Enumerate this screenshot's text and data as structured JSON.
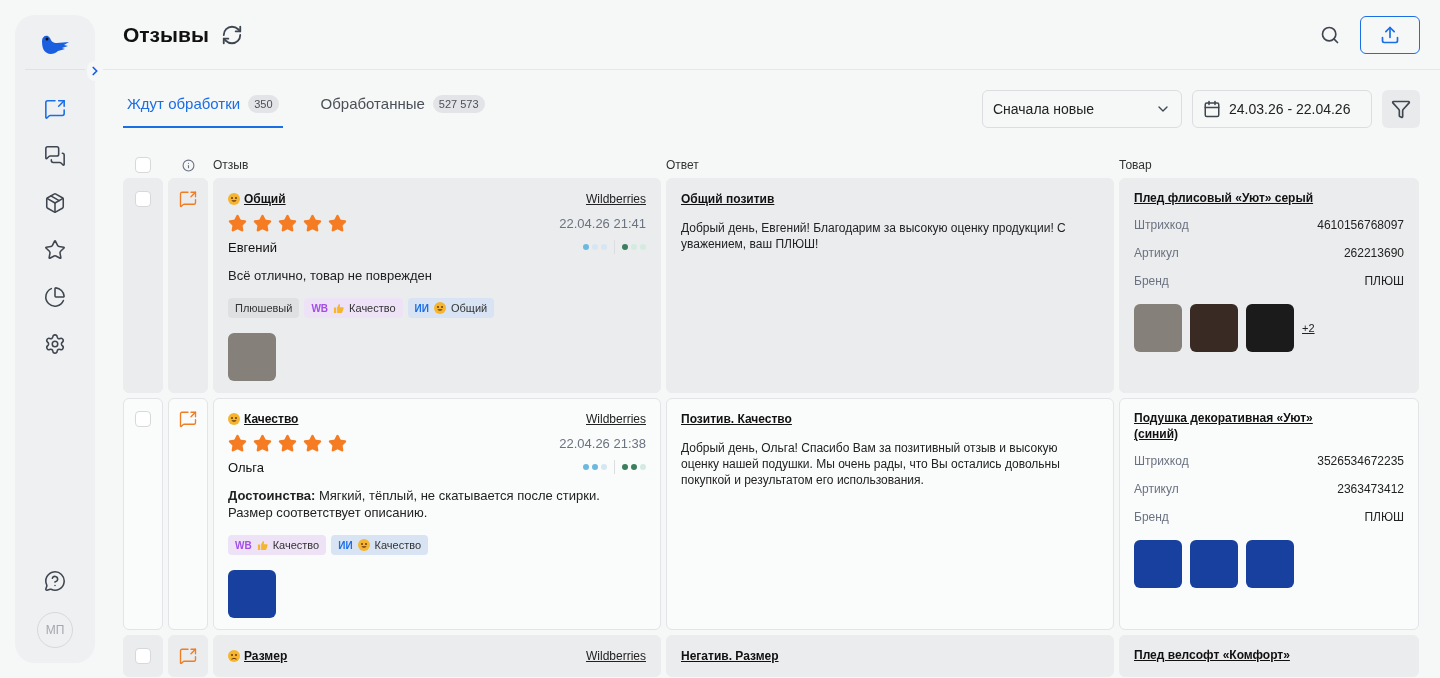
{
  "sidebar": {
    "items": [
      {
        "kind": "reviews",
        "selected": true
      },
      {
        "kind": "chats",
        "selected": false
      },
      {
        "kind": "products",
        "selected": false
      },
      {
        "kind": "ratings",
        "selected": false
      },
      {
        "kind": "analytics",
        "selected": false
      },
      {
        "kind": "settings",
        "selected": false
      }
    ],
    "avatar": "МП"
  },
  "header": {
    "title": "Отзывы"
  },
  "tabs": [
    {
      "label": "Ждут обработки",
      "count": "350",
      "selected": true
    },
    {
      "label": "Обработанные",
      "count": "527 573",
      "selected": false
    }
  ],
  "sort": {
    "value": "Сначала новые"
  },
  "date_range": {
    "value": "24.03.26 - 22.04.26"
  },
  "table": {
    "select_all": {
      "checked": false
    },
    "columns": [
      "Отзыв",
      "Ответ",
      "Товар"
    ],
    "rows": [
      {
        "highlighted": true,
        "checked": false,
        "kind": "positive",
        "topic": "Общий",
        "marketplace": "Wildberries",
        "stars": 5,
        "date": "22.04.26 21:41",
        "author": "Евгений",
        "indicator_a": {
          "level": 0.33
        },
        "indicator_b": {
          "level": 0.33
        },
        "text": "Всё отлично, товар не поврежден",
        "tags": [
          {
            "kind": "plain",
            "label": "Плюшевый"
          },
          {
            "kind": "wb",
            "prefix": "WB",
            "label": "Качество"
          },
          {
            "kind": "ai",
            "prefix": "ИИ",
            "label": "Общий"
          }
        ],
        "photos": [
          {
            "kind": "blanket"
          }
        ],
        "answer_title": "Общий позитив",
        "answer": "Добрый день, Евгений! Благодарим за высокую оценку продукции! С уважением, ваш ПЛЮШ!",
        "product": {
          "title": "Плед флисовый «Уют» серый",
          "fields": [
            {
              "label": "Штрихкод",
              "value": "4610156768097"
            },
            {
              "label": "Артикул",
              "value": "262213690"
            },
            {
              "label": "Бренд",
              "value": "ПЛЮШ"
            }
          ],
          "photos": [
            {
              "kind": "blanket"
            },
            {
              "kind": "brown-fabric"
            },
            {
              "kind": "black-fabric"
            }
          ],
          "more": "+2"
        }
      },
      {
        "highlighted": false,
        "checked": false,
        "kind": "positive",
        "topic": "Качество",
        "marketplace": "Wildberries",
        "stars": 5,
        "date": "22.04.26 21:38",
        "author": "Ольга",
        "indicator_a": {
          "level": 0.67
        },
        "indicator_b": {
          "level": 0.67
        },
        "text": "**Достоинства:** Мягкий, тёплый, не скатывается после стирки. Размер соответствует описанию.",
        "tags": [
          {
            "kind": "wb",
            "prefix": "WB",
            "label": "Качество"
          },
          {
            "kind": "ai",
            "prefix": "ИИ",
            "label": "Качество"
          }
        ],
        "photos": [
          {
            "kind": "pillow"
          }
        ],
        "answer_title": "Позитив. Качество",
        "answer": "Добрый день, Ольга! Спасибо Вам за позитивный отзыв и высокую оценку нашей подушки. Мы очень рады, что Вы остались довольны покупкой и результатом его использования.",
        "product": {
          "title": "Подушка декоративная «Уют» (синий)",
          "fields": [
            {
              "label": "Штрихкод",
              "value": "3526534672235"
            },
            {
              "label": "Артикул",
              "value": "2363473412"
            },
            {
              "label": "Бренд",
              "value": "ПЛЮШ"
            }
          ],
          "photos": [
            {
              "kind": "pillow"
            },
            {
              "kind": "pillow"
            },
            {
              "kind": "pillow"
            }
          ]
        }
      },
      {
        "highlighted": true,
        "checked": false,
        "kind": "negative",
        "topic": "Размер",
        "marketplace": "Wildberries",
        "answer_title": "Негатив. Размер",
        "product": {
          "title": "Плед велсофт «Комфорт»"
        }
      }
    ]
  }
}
